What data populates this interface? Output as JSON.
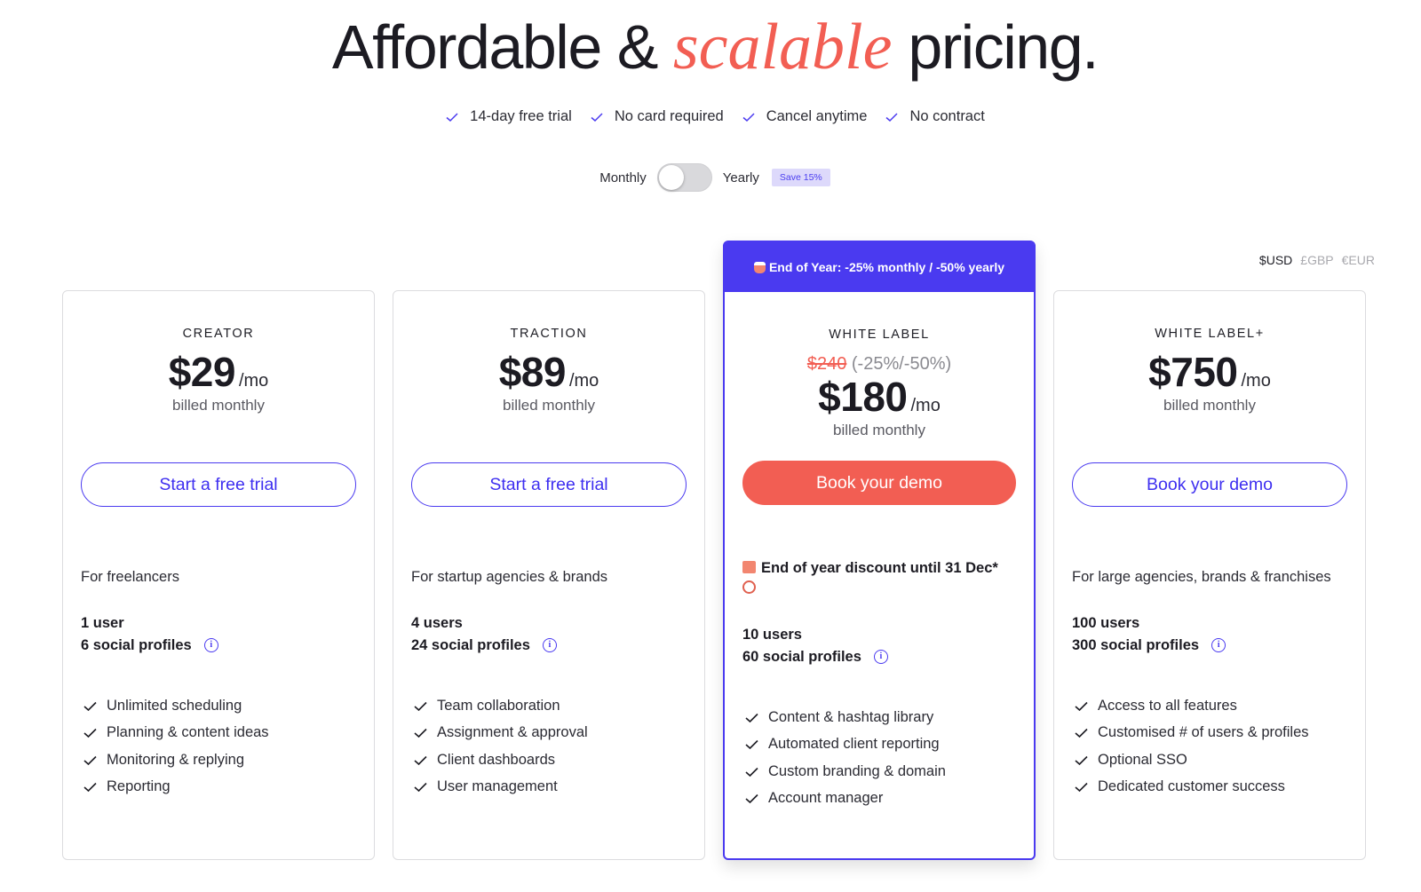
{
  "hero": {
    "title_part1": "Affordable & ",
    "title_accent": "scalable",
    "title_part2": " pricing."
  },
  "perks": [
    {
      "icon": "check-icon",
      "label": "14-day free trial"
    },
    {
      "icon": "check-icon",
      "label": "No card required"
    },
    {
      "icon": "check-icon",
      "label": "Cancel anytime"
    },
    {
      "icon": "check-icon",
      "label": "No contract"
    }
  ],
  "billing": {
    "monthly_label": "Monthly",
    "yearly_label": "Yearly",
    "save_badge": "Save 15%",
    "selected": "Monthly"
  },
  "currency": {
    "options": [
      "$USD",
      "£GBP",
      "€EUR"
    ],
    "selected": "$USD"
  },
  "colors": {
    "accent": "#4a3af0",
    "coral": "#f25e53",
    "text": "#1c1b22"
  },
  "plans": [
    {
      "name": "CREATOR",
      "price": "$29",
      "per": "/mo",
      "billed": "billed monthly",
      "cta": "Start a free trial",
      "audience": "For freelancers",
      "users": "1 user",
      "profiles": "6 social profiles",
      "features": [
        "Unlimited scheduling",
        "Planning & content ideas",
        "Monitoring & replying",
        "Reporting"
      ]
    },
    {
      "name": "TRACTION",
      "price": "$89",
      "per": "/mo",
      "billed": "billed monthly",
      "cta": "Start a free trial",
      "audience": "For startup agencies & brands",
      "users": "4 users",
      "profiles": "24 social profiles",
      "features": [
        "Team collaboration",
        "Assignment & approval",
        "Client dashboards",
        "User management"
      ]
    },
    {
      "name": "WHITE LABEL",
      "promo": "End of Year: -25% monthly / -50% yearly",
      "old_price": "$240",
      "discount": "(-25%/-50%)",
      "price": "$180",
      "per": "/mo",
      "billed": "billed monthly",
      "cta": "Book your demo",
      "discount_note": "End of year discount until 31 Dec*",
      "users": "10 users",
      "profiles": "60 social profiles",
      "features": [
        "Content & hashtag library",
        "Automated client reporting",
        "Custom branding & domain",
        "Account manager"
      ]
    },
    {
      "name": "WHITE LABEL+",
      "price": "$750",
      "per": "/mo",
      "billed": "billed monthly",
      "cta": "Book your demo",
      "audience": "For large agencies, brands & franchises",
      "users": "100 users",
      "profiles": "300 social profiles",
      "features": [
        "Access to all features",
        "Customised # of users & profiles",
        "Optional SSO",
        "Dedicated customer success"
      ]
    }
  ]
}
